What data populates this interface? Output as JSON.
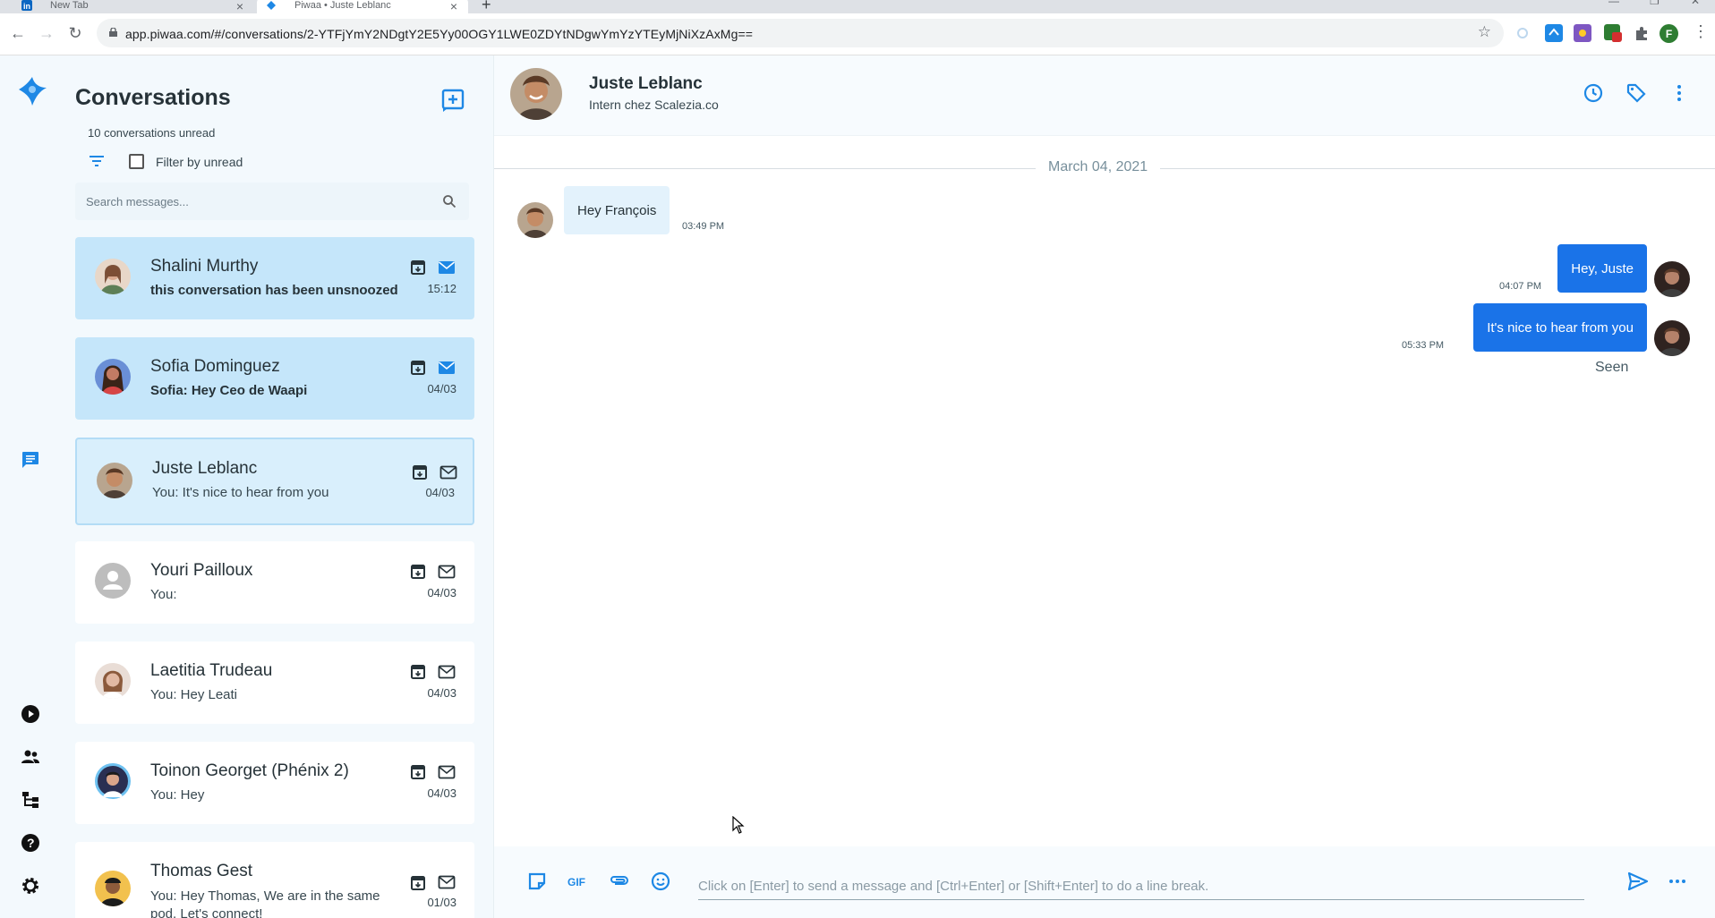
{
  "browser": {
    "tabs": [
      {
        "title": "New Tab",
        "active": false
      },
      {
        "title": "Piwaa • Juste Leblanc",
        "active": true
      }
    ],
    "url": "app.piwaa.com/#/conversations/2-YTFjYmY2NDgtY2E5Yy00OGY1LWE0ZDYtNDgwYmYzYTEyMjNiXzAxMg==",
    "profile_initial": "F",
    "ext_badge": "1"
  },
  "sidebar": {
    "title": "Conversations",
    "unread_count": "10 conversations unread",
    "filter_label": "Filter by unread",
    "search_placeholder": "Search messages..."
  },
  "conversations": [
    {
      "name": "Shalini Murthy",
      "preview": "this conversation has been unsnoozed",
      "time": "15:12",
      "state": "unread",
      "avatar_color": "#d9a98f"
    },
    {
      "name": "Sofia Dominguez",
      "preview": "Sofia: Hey Ceo de Waapi",
      "time": "04/03",
      "state": "unread",
      "avatar_color": "#c27b64"
    },
    {
      "name": "Juste Leblanc",
      "preview": "You: It's nice to hear from you",
      "time": "04/03",
      "state": "selected",
      "avatar_color": "#8a5a3c"
    },
    {
      "name": "Youri Pailloux",
      "preview": "You:",
      "time": "04/03",
      "state": "read",
      "avatar_color": "#bdbdbd"
    },
    {
      "name": "Laetitia Trudeau",
      "preview": "You: Hey Leati",
      "time": "04/03",
      "state": "read",
      "avatar_color": "#c99a88"
    },
    {
      "name": "Toinon Georget (Phénix 2)",
      "preview": "You: Hey",
      "time": "04/03",
      "state": "read",
      "avatar_color": "#4a4f6e"
    },
    {
      "name": "Thomas Gest",
      "preview": "You: Hey Thomas, We are in the same pod. Let's connect!",
      "time": "01/03",
      "state": "read",
      "avatar_color": "#6d4c2f"
    }
  ],
  "chat": {
    "contact_name": "Juste Leblanc",
    "contact_subtitle": "Intern chez Scalezia.co",
    "date_separator": "March 04, 2021",
    "messages": [
      {
        "direction": "in",
        "text": "Hey François",
        "time": "03:49 PM"
      },
      {
        "direction": "out",
        "text": "Hey, Juste",
        "time": "04:07 PM"
      },
      {
        "direction": "out",
        "text": "It's nice to hear from you",
        "time": "05:33 PM"
      }
    ],
    "seen_label": "Seen",
    "composer_placeholder": "Click on [Enter] to send a message and [Ctrl+Enter] or [Shift+Enter] to do a line break."
  },
  "colors": {
    "accent": "#1a73e8",
    "unread_bg": "#c5e6fa",
    "icon_blue": "#1e88e5"
  }
}
